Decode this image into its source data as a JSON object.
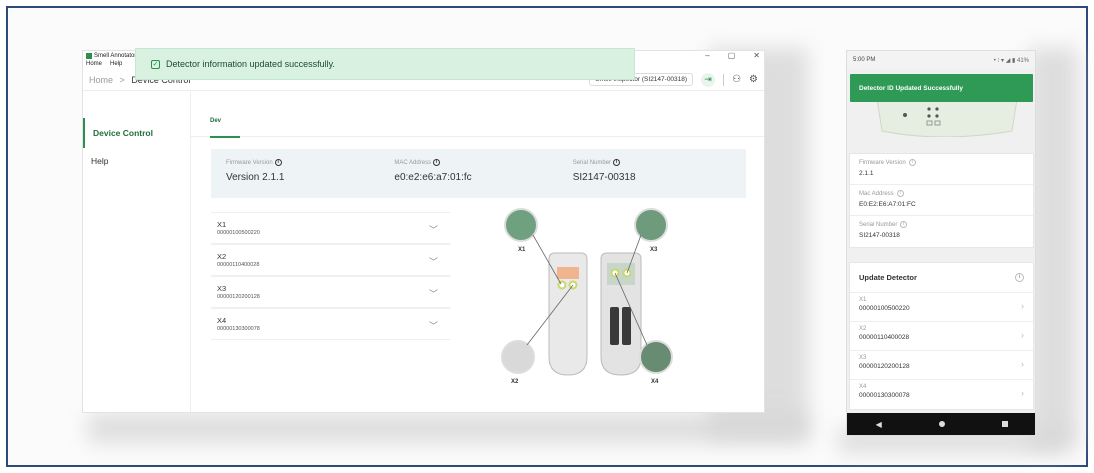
{
  "desktop": {
    "app_title": "Smell Annotator",
    "window_controls": {
      "minimize": "–",
      "maximize": "▢",
      "close": "✕"
    },
    "menu": [
      "Home",
      "Help"
    ],
    "breadcrumb": {
      "home": "Home",
      "separator": ">",
      "current": "Device Control"
    },
    "device_chip": "Smell Inspector (SI2147-00318)",
    "sidebar": [
      {
        "label": "Device Control",
        "active": true
      },
      {
        "label": "Help",
        "active": false
      }
    ],
    "tab_label": "Dev",
    "toast": "Detector information updated successfully.",
    "info": {
      "firmware_label": "Firmware Version",
      "firmware_value": "Version 2.1.1",
      "mac_label": "MAC Address",
      "mac_value": "e0:e2:e6:a7:01:fc",
      "serial_label": "Serial Number",
      "serial_value": "SI2147-00318"
    },
    "detectors": [
      {
        "name": "X1",
        "id": "00000100500220"
      },
      {
        "name": "X2",
        "id": "00000110400028"
      },
      {
        "name": "X3",
        "id": "00000120200128"
      },
      {
        "name": "X4",
        "id": "00000130300078"
      }
    ],
    "diagram_labels": [
      "X1",
      "X3",
      "X2",
      "X4"
    ]
  },
  "phone": {
    "time": "5:00 PM",
    "status_icons": "• ⁝ ▾ ◢ ▮ 41%",
    "toast": "Detector ID Updated Successfully",
    "info": [
      {
        "label": "Firmware Version",
        "value": "2.1.1"
      },
      {
        "label": "Mac Address",
        "value": "E0:E2:E6:A7:01:FC"
      },
      {
        "label": "Serial Number",
        "value": "SI2147-00318"
      }
    ],
    "update_title": "Update Detector",
    "detectors": [
      {
        "name": "X1",
        "id": "00000100500220"
      },
      {
        "name": "X2",
        "id": "00000110400028"
      },
      {
        "name": "X3",
        "id": "00000120200128"
      },
      {
        "name": "X4",
        "id": "00000130300078"
      }
    ],
    "nav": {
      "back": "◀"
    }
  },
  "colors": {
    "accent": "#2c8f4f",
    "toast_bg": "#d8f1e0",
    "phone_toast": "#2f9a55",
    "info_panel": "#eef4f6",
    "frame_border": "#2e4a7a"
  },
  "icons": {
    "info": "i",
    "check": "✓",
    "chevron_down": "﹀",
    "chevron_right": "›",
    "login": "⇥",
    "user": "⚇",
    "gear": "⚙"
  }
}
